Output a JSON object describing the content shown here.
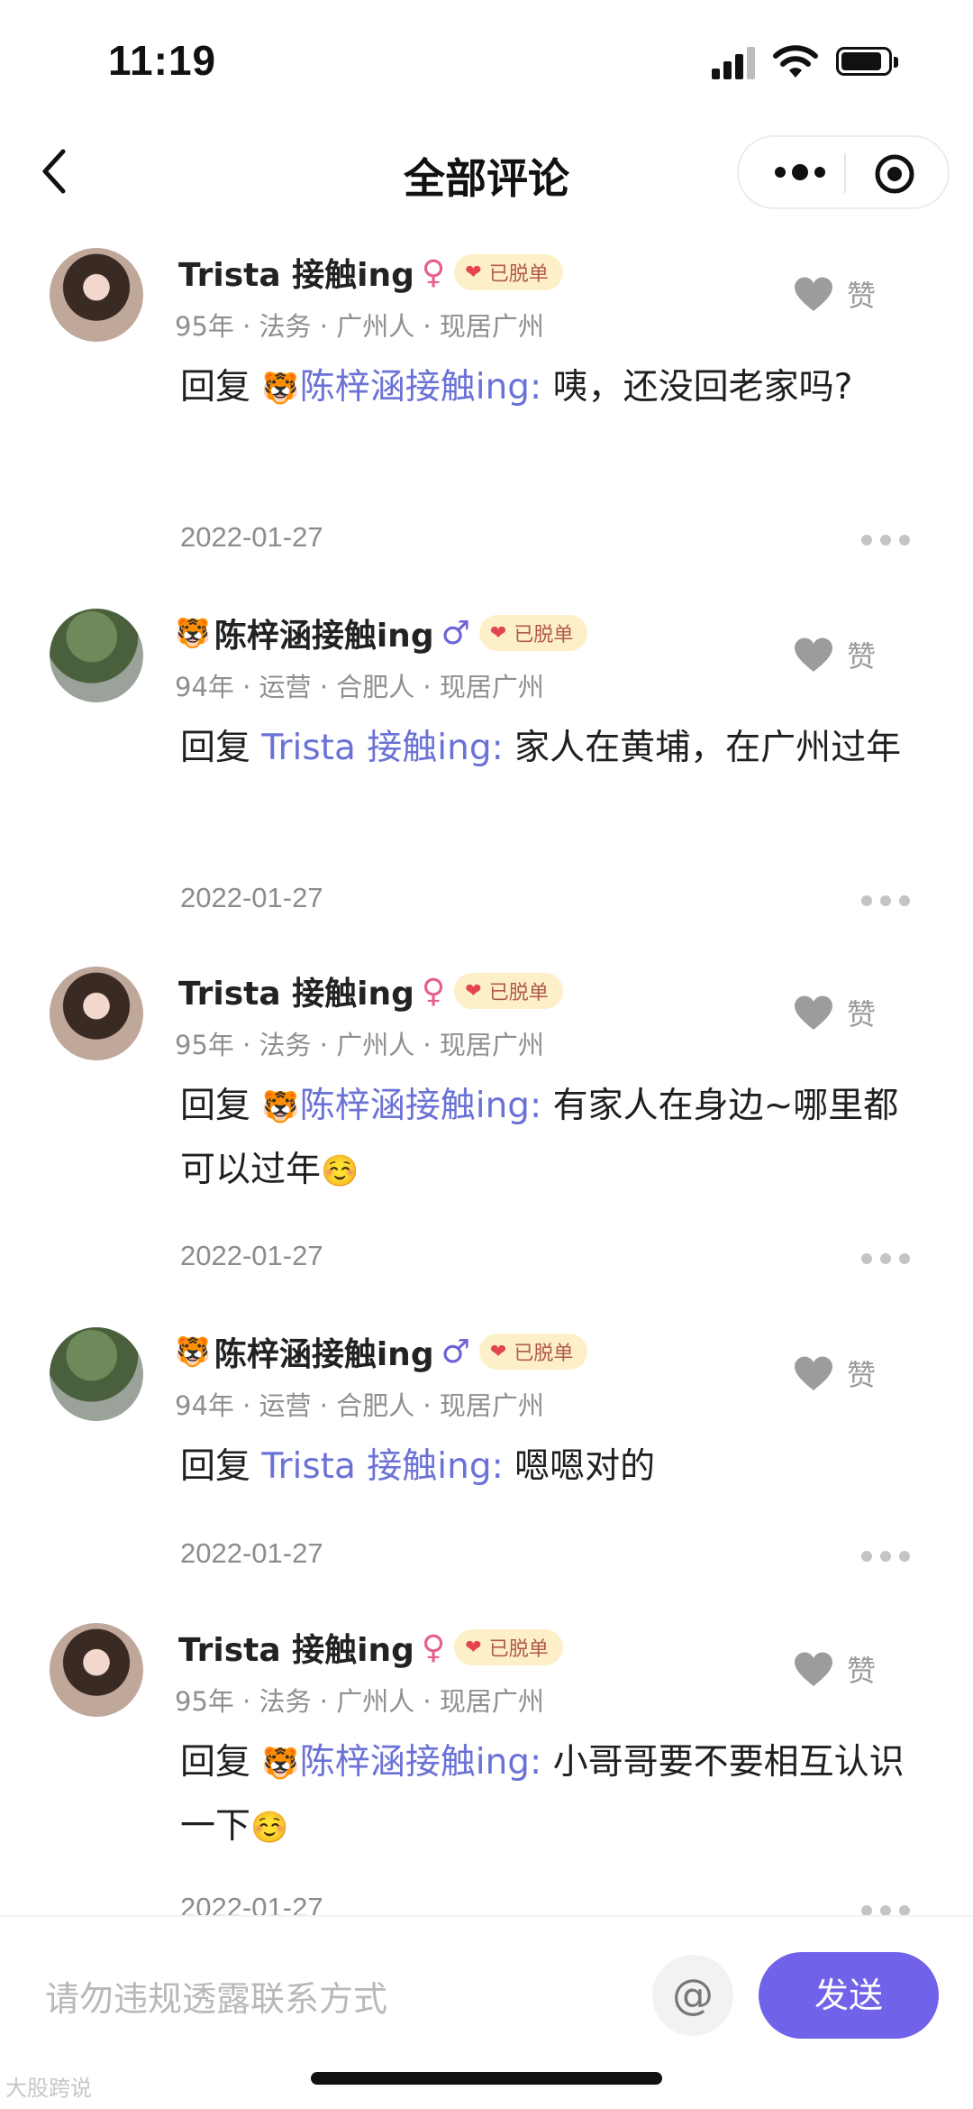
{
  "status_bar": {
    "time": "11:19"
  },
  "nav": {
    "title": "全部评论"
  },
  "comments": [
    {
      "name": "Trista 接触ing",
      "tiger": "",
      "gender": "♀",
      "badge": "已脱单",
      "meta": "95年 · 法务 · 广州人 · 现居广州",
      "reply_prefix": "回复 ",
      "mention_emoji": "🐯",
      "mention": "陈梓涵接触ing:",
      "text": " 咦，还没回老家吗?",
      "trailing_emoji": "",
      "date": "2022-01-27",
      "like_label": "赞"
    },
    {
      "name": "陈梓涵接触ing",
      "tiger": "🐯",
      "gender": "♂",
      "badge": "已脱单",
      "meta": "94年 · 运营 · 合肥人 · 现居广州",
      "reply_prefix": "回复 ",
      "mention_emoji": "",
      "mention": "Trista 接触ing:",
      "text": " 家人在黄埔，在广州过年",
      "trailing_emoji": "",
      "date": "2022-01-27",
      "like_label": "赞"
    },
    {
      "name": "Trista 接触ing",
      "tiger": "",
      "gender": "♀",
      "badge": "已脱单",
      "meta": "95年 · 法务 · 广州人 · 现居广州",
      "reply_prefix": "回复 ",
      "mention_emoji": "🐯",
      "mention": "陈梓涵接触ing:",
      "text": " 有家人在身边~哪里都可以过年",
      "trailing_emoji": "☺️",
      "date": "2022-01-27",
      "like_label": "赞"
    },
    {
      "name": "陈梓涵接触ing",
      "tiger": "🐯",
      "gender": "♂",
      "badge": "已脱单",
      "meta": "94年 · 运营 · 合肥人 · 现居广州",
      "reply_prefix": "回复 ",
      "mention_emoji": "",
      "mention": "Trista 接触ing:",
      "text": " 嗯嗯对的",
      "trailing_emoji": "",
      "date": "2022-01-27",
      "like_label": "赞"
    },
    {
      "name": "Trista 接触ing",
      "tiger": "",
      "gender": "♀",
      "badge": "已脱单",
      "meta": "95年 · 法务 · 广州人 · 现居广州",
      "reply_prefix": "回复 ",
      "mention_emoji": "🐯",
      "mention": "陈梓涵接触ing:",
      "text": " 小哥哥要不要相互认识一下",
      "trailing_emoji": "☺️",
      "date": "2022-01-27",
      "like_label": "赞"
    }
  ],
  "input": {
    "placeholder": "请勿违规透露联系方式",
    "at_label": "@",
    "send_label": "发送"
  },
  "watermark": "大股跨说"
}
